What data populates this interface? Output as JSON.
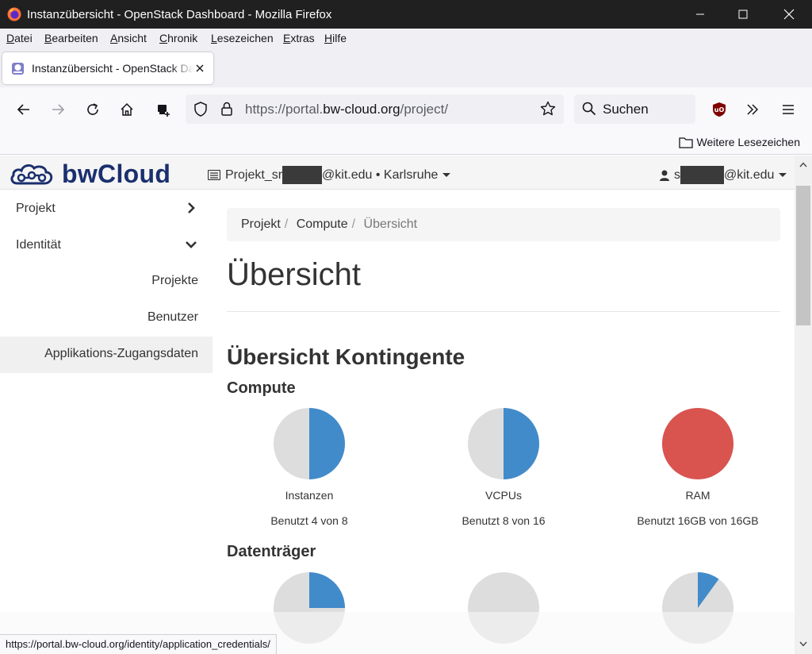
{
  "window": {
    "title": "Instanzübersicht - OpenStack Dashboard - Mozilla Firefox"
  },
  "menubar": [
    "Datei",
    "Bearbeiten",
    "Ansicht",
    "Chronik",
    "Lesezeichen",
    "Extras",
    "Hilfe"
  ],
  "tab": {
    "title": "Instanzübersicht - OpenStack Dashboard",
    "close_icon": "close-icon"
  },
  "navbar": {
    "url_prefix": "https://portal.",
    "url_host": "bw-cloud.org",
    "url_suffix": "/project/",
    "search_placeholder": "Suchen"
  },
  "bookmarks": {
    "more_label": "Weitere Lesezeichen"
  },
  "topnav": {
    "brand": "bwCloud",
    "project_prefix": "Projekt_sr",
    "project_suffix": "@kit.edu • Karlsruhe",
    "user_prefix": "s",
    "user_suffix": "@kit.edu"
  },
  "sidebar": {
    "items": [
      {
        "label": "Projekt",
        "icon": "chevron-right-icon"
      },
      {
        "label": "Identität",
        "icon": "chevron-down-icon"
      }
    ],
    "sub_items": [
      {
        "label": "Projekte",
        "active": false
      },
      {
        "label": "Benutzer",
        "active": false
      },
      {
        "label": "Applikations-Zugangsdaten",
        "active": true
      }
    ]
  },
  "breadcrumb": [
    "Projekt",
    "Compute",
    "Übersicht"
  ],
  "main": {
    "page_title": "Übersicht",
    "limits_title": "Übersicht Kontingente",
    "compute_title": "Compute",
    "volume_title": "Datenträger"
  },
  "colors": {
    "used": "#428bca",
    "full": "#d9534f",
    "free": "#dddddd"
  },
  "chart_data": [
    {
      "type": "pie",
      "group": "Compute",
      "charts": [
        {
          "label": "Instanzen",
          "usage_text": "Benutzt 4 von 8",
          "used": 4,
          "total": 8
        },
        {
          "label": "VCPUs",
          "usage_text": "Benutzt 8 von 16",
          "used": 8,
          "total": 16
        },
        {
          "label": "RAM",
          "usage_text": "Benutzt 16GB von 16GB",
          "used": 16,
          "total": 16
        }
      ]
    },
    {
      "type": "pie",
      "group": "Datenträger",
      "charts": [
        {
          "fraction": 0.25
        },
        {
          "fraction": 0
        },
        {
          "fraction": 0.1
        }
      ]
    }
  ],
  "statusbar": {
    "text": "https://portal.bw-cloud.org/identity/application_credentials/"
  }
}
